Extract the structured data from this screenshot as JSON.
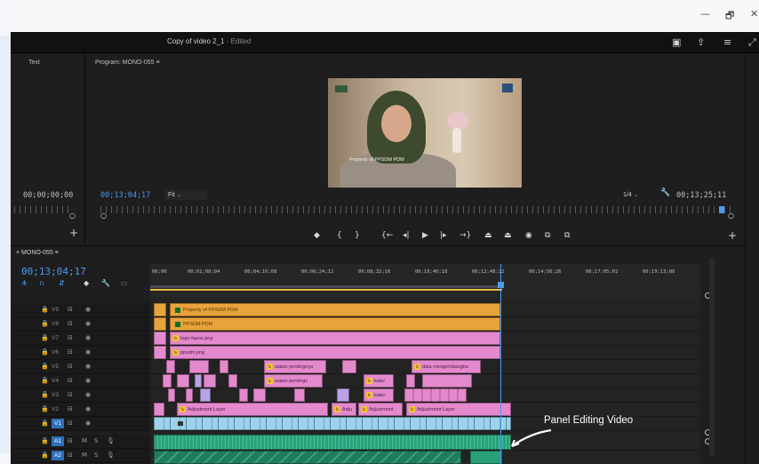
{
  "window": {
    "title": "Copy of video 2_1",
    "edited_suffix": " - Edited",
    "controls": {
      "minimize": "—",
      "maximize": "🗗",
      "close": "✕"
    }
  },
  "source_panel": {
    "title": "Text",
    "timecode": "00;00;00;00"
  },
  "program_panel": {
    "title": "Program: MONO-055",
    "menu_icon": "≡",
    "timecode": "00;13;04;17",
    "fit_label": "Fit",
    "resolution": "1/4",
    "duration": "00;13;25;11",
    "video_watermark": "Property of PPSDM PDM",
    "controls": [
      "marker-icon",
      "in-point-icon",
      "out-point-icon",
      "go-to-in-icon",
      "step-back-icon",
      "play-icon",
      "step-forward-icon",
      "go-to-out-icon",
      "lift-icon",
      "extract-icon",
      "export-frame-icon",
      "insert-icon",
      "overwrite-icon"
    ]
  },
  "timeline": {
    "sequence_tab": "MONO-055",
    "timecode": "00;13;04;17",
    "ticks": [
      "00;00",
      "00;02;08;04",
      "00;04;16;08",
      "00;06;24;12",
      "00;08;32;16",
      "00;10;40;18",
      "00;12;48;22",
      "00;14;56;26",
      "00;17;05;02",
      "00;19;13;06"
    ],
    "tracks": [
      {
        "name": "V9"
      },
      {
        "name": "V8"
      },
      {
        "name": "V7"
      },
      {
        "name": "V6"
      },
      {
        "name": "V5"
      },
      {
        "name": "V4"
      },
      {
        "name": "V3"
      },
      {
        "name": "V2"
      },
      {
        "name": "V1",
        "selected": true
      },
      {
        "name": "A1",
        "selected": true
      },
      {
        "name": "A2",
        "selected": true
      }
    ],
    "clips": {
      "v9": "Property of PPSDM PDM",
      "v8": "PPSDM PDM",
      "v7": "logo-fapos.png",
      "v6": "ppsdm.png",
      "v5_a": "siatan pentingnya",
      "v5_b": "data mengembangka",
      "v4_a": "siatan pentingn",
      "v4_b": "kater",
      "v3": "kater",
      "v2_a": "Adjustment Layer",
      "v2_b": "Adju",
      "v2_c": "Adjustment",
      "v2_d": "Adjustment Layer"
    }
  },
  "annotation": {
    "text": "Panel Editing Video"
  },
  "colors": {
    "playhead": "#4a9bf0",
    "clip_orange": "#e8a33a",
    "clip_pink": "#e489cd",
    "clip_blue": "#9ed2ea",
    "clip_green": "#29a07a"
  }
}
